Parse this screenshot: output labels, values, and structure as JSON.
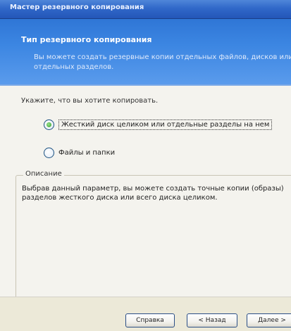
{
  "window": {
    "title": "Мастер резервного копирования"
  },
  "header": {
    "title": "Тип резервного копирования",
    "description": "Вы можете создать резервные копии отдельных файлов, дисков или отдельных разделов."
  },
  "body": {
    "instruction": "Укажите, что вы хотите копировать.",
    "options": [
      {
        "label": "Жесткий диск целиком или отдельные разделы на нем",
        "selected": true
      },
      {
        "label": "Файлы и папки",
        "selected": false
      }
    ],
    "description_group": {
      "legend": "Описание",
      "text": "Выбрав данный параметр, вы можете создать точные копии (образы) разделов жесткого диска или всего диска целиком."
    }
  },
  "footer": {
    "help_label": "Справка",
    "back_label": "< Назад",
    "next_label": "Далее >"
  },
  "colors": {
    "accent": "#3c86e2",
    "radio_selected": "#2f9b2a"
  }
}
